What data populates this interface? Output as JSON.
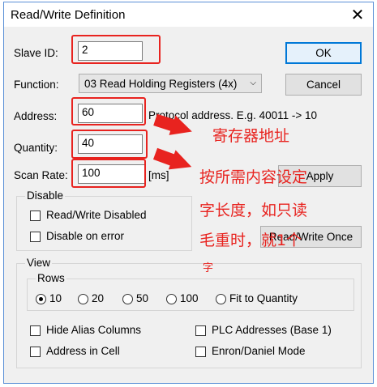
{
  "window": {
    "title": "Read/Write Definition",
    "close_glyph": "✕"
  },
  "fields": {
    "slave_id": {
      "label": "Slave ID:",
      "value": "2"
    },
    "function": {
      "label": "Function:",
      "value": "03 Read Holding Registers (4x)"
    },
    "address": {
      "label": "Address:",
      "value": "60",
      "hint": "Protocol address. E.g. 40011 -> 10"
    },
    "quantity": {
      "label": "Quantity:",
      "value": "40"
    },
    "scan_rate": {
      "label": "Scan Rate:",
      "value": "100",
      "unit": "[ms]"
    }
  },
  "buttons": {
    "ok": "OK",
    "cancel": "Cancel",
    "apply": "Apply",
    "read_write_once": "Read/Write Once"
  },
  "disable_group": {
    "title": "Disable",
    "read_write_disabled": "Read/Write Disabled",
    "disable_on_error": "Disable on error"
  },
  "view_group": {
    "title": "View",
    "rows_title": "Rows",
    "rows_options": [
      "10",
      "20",
      "50",
      "100",
      "Fit to Quantity"
    ],
    "rows_selected": "10",
    "hide_alias_columns": "Hide Alias Columns",
    "plc_addresses": "PLC Addresses (Base 1)",
    "address_in_cell": "Address in Cell",
    "enron_daniel": "Enron/Daniel Mode"
  },
  "annotations": {
    "register_address": "寄存器地址",
    "line1": "按所需内容设定",
    "line2": "字长度，如只读",
    "line3": "毛重时，就1个",
    "line4": "字"
  },
  "colors": {
    "annotation_red": "#e8231f",
    "ok_border": "#0078d7"
  }
}
